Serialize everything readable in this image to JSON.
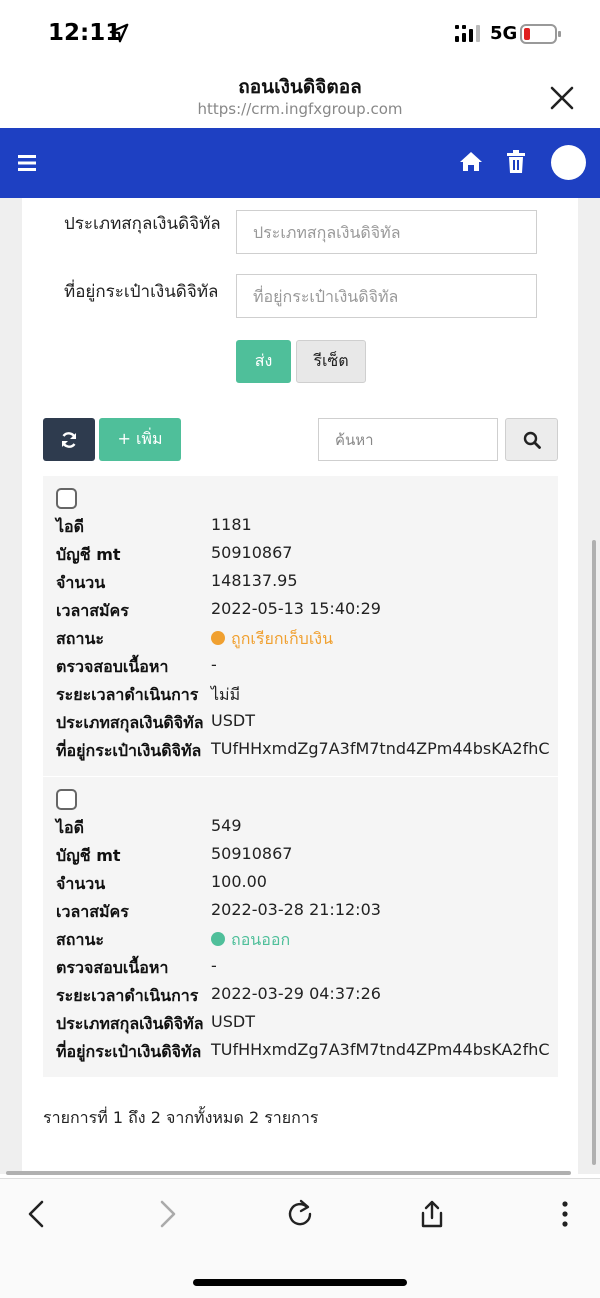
{
  "status_bar": {
    "time": "12:11",
    "network": "5G"
  },
  "browser": {
    "title": "ถอนเงินดิจิตอล",
    "url": "https://crm.ingfxgroup.com"
  },
  "form": {
    "currency_type_label": "ประเภทสกุลเงินดิจิทัล",
    "currency_type_placeholder": "ประเภทสกุลเงินดิจิทัล",
    "wallet_address_label": "ที่อยู่กระเป๋าเงินดิจิทัล",
    "wallet_address_placeholder": "ที่อยู่กระเป๋าเงินดิจิทัล",
    "send_label": "ส่ง",
    "reset_label": "รีเซ็ต"
  },
  "toolbar": {
    "add_label": "+ เพิ่ม",
    "search_placeholder": "ค้นหา"
  },
  "field_labels": {
    "id": "ไอดี",
    "mt_account": "บัญชี mt",
    "amount": "จำนวน",
    "register_time": "เวลาสมัคร",
    "status": "สถานะ",
    "check_content": "ตรวจสอบเนื้อหา",
    "processing_time": "ระยะเวลาดำเนินการ",
    "currency_type": "ประเภทสกุลเงินดิจิทัล",
    "wallet_address": "ที่อยู่กระเป๋าเงินดิจิทัล"
  },
  "records": [
    {
      "id": "1181",
      "mt_account": "50910867",
      "amount": "148137.95",
      "register_time": "2022-05-13 15:40:29",
      "status": "ถูกเรียกเก็บเงิน",
      "status_color": "#f0a030",
      "check_content": "-",
      "processing_time": "ไม่มี",
      "currency_type": "USDT",
      "wallet_address": "TUfHHxmdZg7A3fM7tnd4ZPm44bsKA2fhC"
    },
    {
      "id": "549",
      "mt_account": "50910867",
      "amount": "100.00",
      "register_time": "2022-03-28 21:12:03",
      "status": "ถอนออก",
      "status_color": "#4fbf9a",
      "check_content": "-",
      "processing_time": "2022-03-29 04:37:26",
      "currency_type": "USDT",
      "wallet_address": "TUfHHxmdZg7A3fM7tnd4ZPm44bsKA2fhC"
    }
  ],
  "pagination_info": "รายการที่ 1 ถึง 2 จากทั้งหมด 2 รายการ",
  "colors": {
    "navbar": "#1e40c2",
    "success": "#4fbf9a",
    "dark": "#2e3b4e",
    "warning": "#f0a030"
  }
}
